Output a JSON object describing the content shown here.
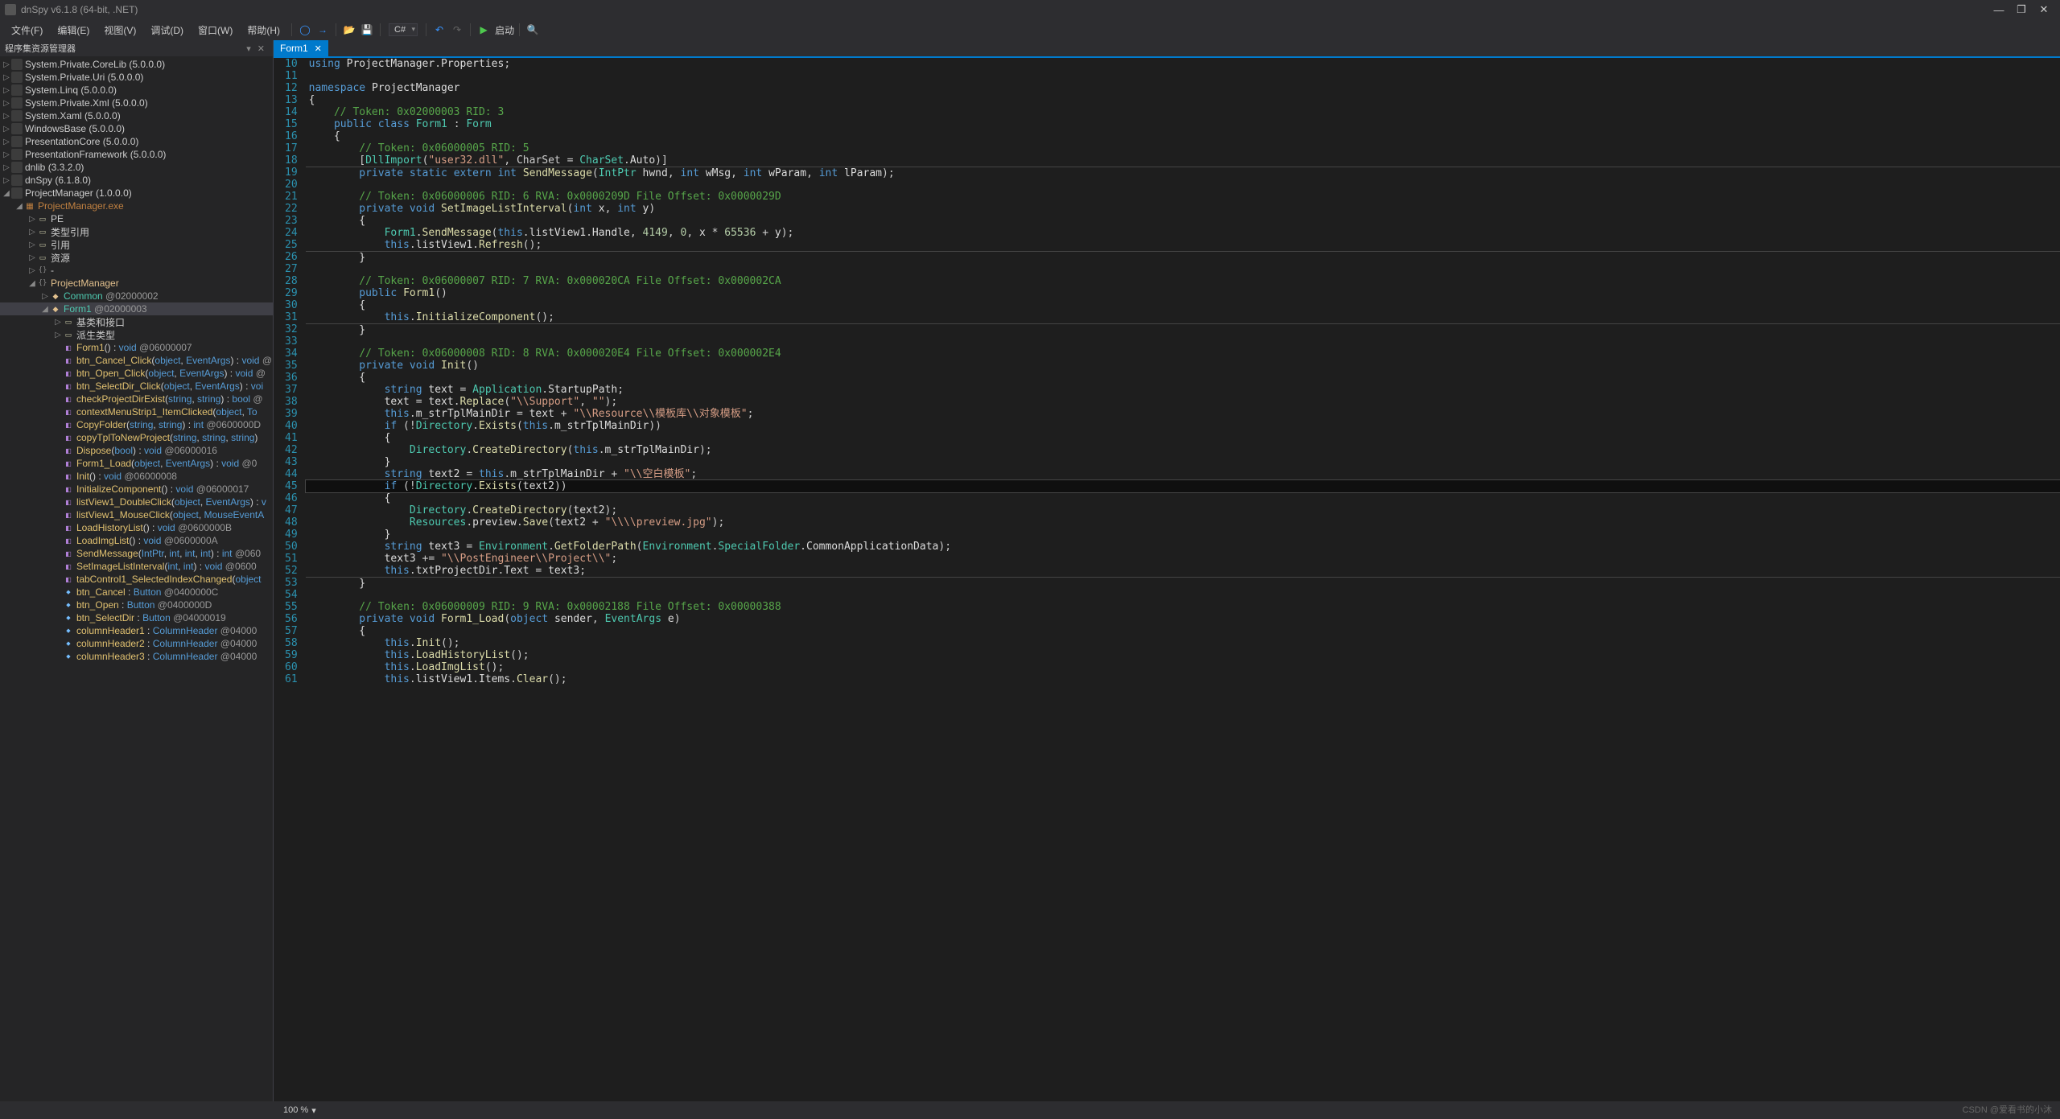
{
  "window": {
    "title": "dnSpy v6.1.8 (64-bit, .NET)"
  },
  "menu": {
    "file": "文件(F)",
    "edit": "编辑(E)",
    "view": "视图(V)",
    "debug": "调试(D)",
    "window": "窗口(W)",
    "help": "帮助(H)",
    "lang": "C#",
    "start": "启动"
  },
  "panel": {
    "title": "程序集资源管理器"
  },
  "assemblies": [
    "System.Private.CoreLib (5.0.0.0)",
    "System.Private.Uri (5.0.0.0)",
    "System.Linq (5.0.0.0)",
    "System.Private.Xml (5.0.0.0)",
    "System.Xaml (5.0.0.0)",
    "WindowsBase (5.0.0.0)",
    "PresentationCore (5.0.0.0)",
    "PresentationFramework (5.0.0.0)",
    "dnlib (3.3.2.0)",
    "dnSpy (6.1.8.0)",
    "ProjectManager (1.0.0.0)"
  ],
  "module": "ProjectManager.exe",
  "modChildren": {
    "pe": "PE",
    "typeref": "类型引用",
    "ref": "引用",
    "res": "资源",
    "dash": "-"
  },
  "ns": "ProjectManager",
  "nsChildren": {
    "common": "Common @02000002",
    "form1": "Form1 @02000003",
    "base": "基类和接口",
    "derived": "派生类型"
  },
  "members": [
    {
      "kind": "meth",
      "sig_html": "<span class='method-name'>Form1</span><span class='paren'>() : </span><span class='type-name'>void</span> <span class='addr'>@06000007</span>"
    },
    {
      "kind": "meth",
      "sig_html": "<span class='method-name'>btn_Cancel_Click</span><span class='paren'>(</span><span class='type-name'>object</span><span class='paren'>, </span><span class='type-name'>EventArgs</span><span class='paren'>) : </span><span class='type-name'>void</span> <span class='addr'>@</span>"
    },
    {
      "kind": "meth",
      "sig_html": "<span class='method-name'>btn_Open_Click</span><span class='paren'>(</span><span class='type-name'>object</span><span class='paren'>, </span><span class='type-name'>EventArgs</span><span class='paren'>) : </span><span class='type-name'>void</span> <span class='addr'>@</span>"
    },
    {
      "kind": "meth",
      "sig_html": "<span class='method-name'>btn_SelectDir_Click</span><span class='paren'>(</span><span class='type-name'>object</span><span class='paren'>, </span><span class='type-name'>EventArgs</span><span class='paren'>) : </span><span class='type-name'>voi</span>"
    },
    {
      "kind": "meth",
      "sig_html": "<span class='method-name'>checkProjectDirExist</span><span class='paren'>(</span><span class='type-name'>string</span><span class='paren'>, </span><span class='type-name'>string</span><span class='paren'>) : </span><span class='type-name'>bool</span> <span class='addr'>@</span>"
    },
    {
      "kind": "meth",
      "sig_html": "<span class='method-name'>contextMenuStrip1_ItemClicked</span><span class='paren'>(</span><span class='type-name'>object</span><span class='paren'>, </span><span class='type-name'>To</span>"
    },
    {
      "kind": "meth",
      "sig_html": "<span class='method-name'>CopyFolder</span><span class='paren'>(</span><span class='type-name'>string</span><span class='paren'>, </span><span class='type-name'>string</span><span class='paren'>) : </span><span class='type-name'>int</span> <span class='addr'>@0600000D</span>"
    },
    {
      "kind": "meth",
      "sig_html": "<span class='method-name'>copyTplToNewProject</span><span class='paren'>(</span><span class='type-name'>string</span><span class='paren'>, </span><span class='type-name'>string</span><span class='paren'>, </span><span class='type-name'>string</span><span class='paren'>)</span>"
    },
    {
      "kind": "meth",
      "sig_html": "<span class='method-name'>Dispose</span><span class='paren'>(</span><span class='type-name'>bool</span><span class='paren'>) : </span><span class='type-name'>void</span> <span class='addr'>@06000016</span>"
    },
    {
      "kind": "meth",
      "sig_html": "<span class='method-name'>Form1_Load</span><span class='paren'>(</span><span class='type-name'>object</span><span class='paren'>, </span><span class='type-name'>EventArgs</span><span class='paren'>) : </span><span class='type-name'>void</span> <span class='addr'>@0</span>"
    },
    {
      "kind": "meth",
      "sig_html": "<span class='method-name'>Init</span><span class='paren'>() : </span><span class='type-name'>void</span> <span class='addr'>@06000008</span>"
    },
    {
      "kind": "meth",
      "sig_html": "<span class='method-name'>InitializeComponent</span><span class='paren'>() : </span><span class='type-name'>void</span> <span class='addr'>@06000017</span>"
    },
    {
      "kind": "meth",
      "sig_html": "<span class='method-name'>listView1_DoubleClick</span><span class='paren'>(</span><span class='type-name'>object</span><span class='paren'>, </span><span class='type-name'>EventArgs</span><span class='paren'>) : </span><span class='type-name'>v</span>"
    },
    {
      "kind": "meth",
      "sig_html": "<span class='method-name'>listView1_MouseClick</span><span class='paren'>(</span><span class='type-name'>object</span><span class='paren'>, </span><span class='type-name'>MouseEventA</span>"
    },
    {
      "kind": "meth",
      "sig_html": "<span class='method-name'>LoadHistoryList</span><span class='paren'>() : </span><span class='type-name'>void</span> <span class='addr'>@0600000B</span>"
    },
    {
      "kind": "meth",
      "sig_html": "<span class='method-name'>LoadImgList</span><span class='paren'>() : </span><span class='type-name'>void</span> <span class='addr'>@0600000A</span>"
    },
    {
      "kind": "meth",
      "sig_html": "<span class='method-name'>SendMessage</span><span class='paren'>(</span><span class='type-name'>IntPtr</span><span class='paren'>, </span><span class='type-name'>int</span><span class='paren'>, </span><span class='type-name'>int</span><span class='paren'>, </span><span class='type-name'>int</span><span class='paren'>) : </span><span class='type-name'>int</span> <span class='addr'>@060</span>"
    },
    {
      "kind": "meth",
      "sig_html": "<span class='method-name'>SetImageListInterval</span><span class='paren'>(</span><span class='type-name'>int</span><span class='paren'>, </span><span class='type-name'>int</span><span class='paren'>) : </span><span class='type-name'>void</span> <span class='addr'>@0600</span>"
    },
    {
      "kind": "meth",
      "sig_html": "<span class='method-name'>tabControl1_SelectedIndexChanged</span><span class='paren'>(</span><span class='type-name'>object</span>"
    },
    {
      "kind": "fld",
      "sig_html": "<span class='method-name'>btn_Cancel</span><span class='paren'> : </span><span class='type-name'>Button</span> <span class='addr'>@0400000C</span>"
    },
    {
      "kind": "fld",
      "sig_html": "<span class='method-name'>btn_Open</span><span class='paren'> : </span><span class='type-name'>Button</span> <span class='addr'>@0400000D</span>"
    },
    {
      "kind": "fld",
      "sig_html": "<span class='method-name'>btn_SelectDir</span><span class='paren'> : </span><span class='type-name'>Button</span> <span class='addr'>@04000019</span>"
    },
    {
      "kind": "fld",
      "sig_html": "<span class='method-name'>columnHeader1</span><span class='paren'> : </span><span class='type-name'>ColumnHeader</span> <span class='addr'>@04000</span>"
    },
    {
      "kind": "fld",
      "sig_html": "<span class='method-name'>columnHeader2</span><span class='paren'> : </span><span class='type-name'>ColumnHeader</span> <span class='addr'>@04000</span>"
    },
    {
      "kind": "fld",
      "sig_html": "<span class='method-name'>columnHeader3</span><span class='paren'> : </span><span class='type-name'>ColumnHeader</span> <span class='addr'>@04000</span>"
    }
  ],
  "tab": {
    "name": "Form1"
  },
  "code": [
    {
      "n": 10,
      "html": "<span class='kw'>using</span> <span class='white'>ProjectManager</span>.<span class='white'>Properties</span>;"
    },
    {
      "n": 11,
      "html": ""
    },
    {
      "n": 12,
      "html": "<span class='kw'>namespace</span> <span class='white'>ProjectManager</span>"
    },
    {
      "n": 13,
      "html": "<span class='white'>{</span>"
    },
    {
      "n": 14,
      "html": "    <span class='cmt'>// Token: 0x02000003 RID: 3</span>"
    },
    {
      "n": 15,
      "html": "    <span class='kw'>public</span> <span class='kw'>class</span> <span class='type'>Form1</span> : <span class='type'>Form</span>"
    },
    {
      "n": 16,
      "html": "    <span class='white'>{</span>"
    },
    {
      "n": 17,
      "html": "        <span class='cmt'>// Token: 0x06000005 RID: 5</span>"
    },
    {
      "n": 18,
      "html": "        [<span class='type'>DllImport</span>(<span class='str'>\"user32.dll\"</span>, CharSet = <span class='type'>CharSet</span>.<span class='white'>Auto</span>)]"
    },
    {
      "n": 19,
      "html": "        <span class='kw'>private</span> <span class='kw'>static</span> <span class='kw'>extern</span> <span class='kw'>int</span> <span class='mth'>SendMessage</span>(<span class='type'>IntPtr</span> <span class='white'>hwnd</span>, <span class='kw'>int</span> <span class='white'>wMsg</span>, <span class='kw'>int</span> <span class='white'>wParam</span>, <span class='kw'>int</span> <span class='white'>lParam</span>);",
      "sep": true
    },
    {
      "n": 20,
      "html": ""
    },
    {
      "n": 21,
      "html": "        <span class='cmt'>// Token: 0x06000006 RID: 6 RVA: 0x0000209D File Offset: 0x0000029D</span>"
    },
    {
      "n": 22,
      "html": "        <span class='kw'>private</span> <span class='kw'>void</span> <span class='mth'>SetImageListInterval</span>(<span class='kw'>int</span> <span class='white'>x</span>, <span class='kw'>int</span> <span class='white'>y</span>)"
    },
    {
      "n": 23,
      "html": "        <span class='white'>{</span>"
    },
    {
      "n": 24,
      "html": "            <span class='type'>Form1</span>.<span class='mth'>SendMessage</span>(<span class='kw'>this</span>.<span class='white'>listView1</span>.<span class='white'>Handle</span>, <span class='num'>4149</span>, <span class='num'>0</span>, <span class='white'>x</span> * <span class='num'>65536</span> + <span class='white'>y</span>);"
    },
    {
      "n": 25,
      "html": "            <span class='kw'>this</span>.<span class='white'>listView1</span>.<span class='mth'>Refresh</span>();"
    },
    {
      "n": 26,
      "html": "        <span class='white'>}</span>",
      "sep": true
    },
    {
      "n": 27,
      "html": ""
    },
    {
      "n": 28,
      "html": "        <span class='cmt'>// Token: 0x06000007 RID: 7 RVA: 0x000020CA File Offset: 0x000002CA</span>"
    },
    {
      "n": 29,
      "html": "        <span class='kw'>public</span> <span class='mth'>Form1</span>()"
    },
    {
      "n": 30,
      "html": "        <span class='white'>{</span>"
    },
    {
      "n": 31,
      "html": "            <span class='kw'>this</span>.<span class='mth'>InitializeComponent</span>();"
    },
    {
      "n": 32,
      "html": "        <span class='white'>}</span>",
      "sep": true
    },
    {
      "n": 33,
      "html": ""
    },
    {
      "n": 34,
      "html": "        <span class='cmt'>// Token: 0x06000008 RID: 8 RVA: 0x000020E4 File Offset: 0x000002E4</span>"
    },
    {
      "n": 35,
      "html": "        <span class='kw'>private</span> <span class='kw'>void</span> <span class='mth'>Init</span>()"
    },
    {
      "n": 36,
      "html": "        <span class='white'>{</span>"
    },
    {
      "n": 37,
      "html": "            <span class='kw'>string</span> <span class='white'>text</span> = <span class='type'>Application</span>.<span class='white'>StartupPath</span>;"
    },
    {
      "n": 38,
      "html": "            <span class='white'>text</span> = <span class='white'>text</span>.<span class='mth'>Replace</span>(<span class='str'>\"\\\\Support\"</span>, <span class='str'>\"\"</span>);"
    },
    {
      "n": 39,
      "html": "            <span class='kw'>this</span>.<span class='white'>m_strTplMainDir</span> = <span class='white'>text</span> + <span class='str'>\"\\\\Resource\\\\模板库\\\\对象模板\"</span>;"
    },
    {
      "n": 40,
      "html": "            <span class='kw'>if</span> (!<span class='type'>Directory</span>.<span class='mth'>Exists</span>(<span class='kw'>this</span>.<span class='white'>m_strTplMainDir</span>))"
    },
    {
      "n": 41,
      "html": "            <span class='white'>{</span>"
    },
    {
      "n": 42,
      "html": "                <span class='type'>Directory</span>.<span class='mth'>CreateDirectory</span>(<span class='kw'>this</span>.<span class='white'>m_strTplMainDir</span>);"
    },
    {
      "n": 43,
      "html": "            <span class='white'>}</span>"
    },
    {
      "n": 44,
      "html": "            <span class='kw'>string</span> <span class='white'>text2</span> = <span class='kw'>this</span>.<span class='white'>m_strTplMainDir</span> + <span class='str'>\"\\\\空白模板\"</span>;"
    },
    {
      "n": 45,
      "html": "            <span class='kw'>if</span> (!<span class='type'>Directory</span>.<span class='mth'>Exists</span>(<span class='white'>text2</span>))",
      "hl": true
    },
    {
      "n": 46,
      "html": "            <span class='white'>{</span>"
    },
    {
      "n": 47,
      "html": "                <span class='type'>Directory</span>.<span class='mth'>CreateDirectory</span>(<span class='white'>text2</span>);"
    },
    {
      "n": 48,
      "html": "                <span class='type'>Resources</span>.<span class='white'>preview</span>.<span class='mth'>Save</span>(<span class='white'>text2</span> + <span class='str'>\"\\\\\\\\preview.jpg\"</span>);"
    },
    {
      "n": 49,
      "html": "            <span class='white'>}</span>"
    },
    {
      "n": 50,
      "html": "            <span class='kw'>string</span> <span class='white'>text3</span> = <span class='type'>Environment</span>.<span class='mth'>GetFolderPath</span>(<span class='type'>Environment</span>.<span class='type'>SpecialFolder</span>.<span class='white'>CommonApplicationData</span>);"
    },
    {
      "n": 51,
      "html": "            <span class='white'>text3</span> += <span class='str'>\"\\\\PostEngineer\\\\Project\\\\\"</span>;"
    },
    {
      "n": 52,
      "html": "            <span class='kw'>this</span>.<span class='white'>txtProjectDir</span>.<span class='white'>Text</span> = <span class='white'>text3</span>;"
    },
    {
      "n": 53,
      "html": "        <span class='white'>}</span>",
      "sep": true
    },
    {
      "n": 54,
      "html": ""
    },
    {
      "n": 55,
      "html": "        <span class='cmt'>// Token: 0x06000009 RID: 9 RVA: 0x00002188 File Offset: 0x00000388</span>"
    },
    {
      "n": 56,
      "html": "        <span class='kw'>private</span> <span class='kw'>void</span> <span class='mth'>Form1_Load</span>(<span class='kw'>object</span> <span class='white'>sender</span>, <span class='type'>EventArgs</span> <span class='white'>e</span>)"
    },
    {
      "n": 57,
      "html": "        <span class='white'>{</span>"
    },
    {
      "n": 58,
      "html": "            <span class='kw'>this</span>.<span class='mth'>Init</span>();"
    },
    {
      "n": 59,
      "html": "            <span class='kw'>this</span>.<span class='mth'>LoadHistoryList</span>();"
    },
    {
      "n": 60,
      "html": "            <span class='kw'>this</span>.<span class='mth'>LoadImgList</span>();"
    },
    {
      "n": 61,
      "html": "            <span class='kw'>this</span>.<span class='white'>listView1</span>.<span class='white'>Items</span>.<span class='mth'>Clear</span>();"
    }
  ],
  "status": {
    "zoom": "100 %"
  },
  "watermark": "CSDN @爱看书的小沐"
}
